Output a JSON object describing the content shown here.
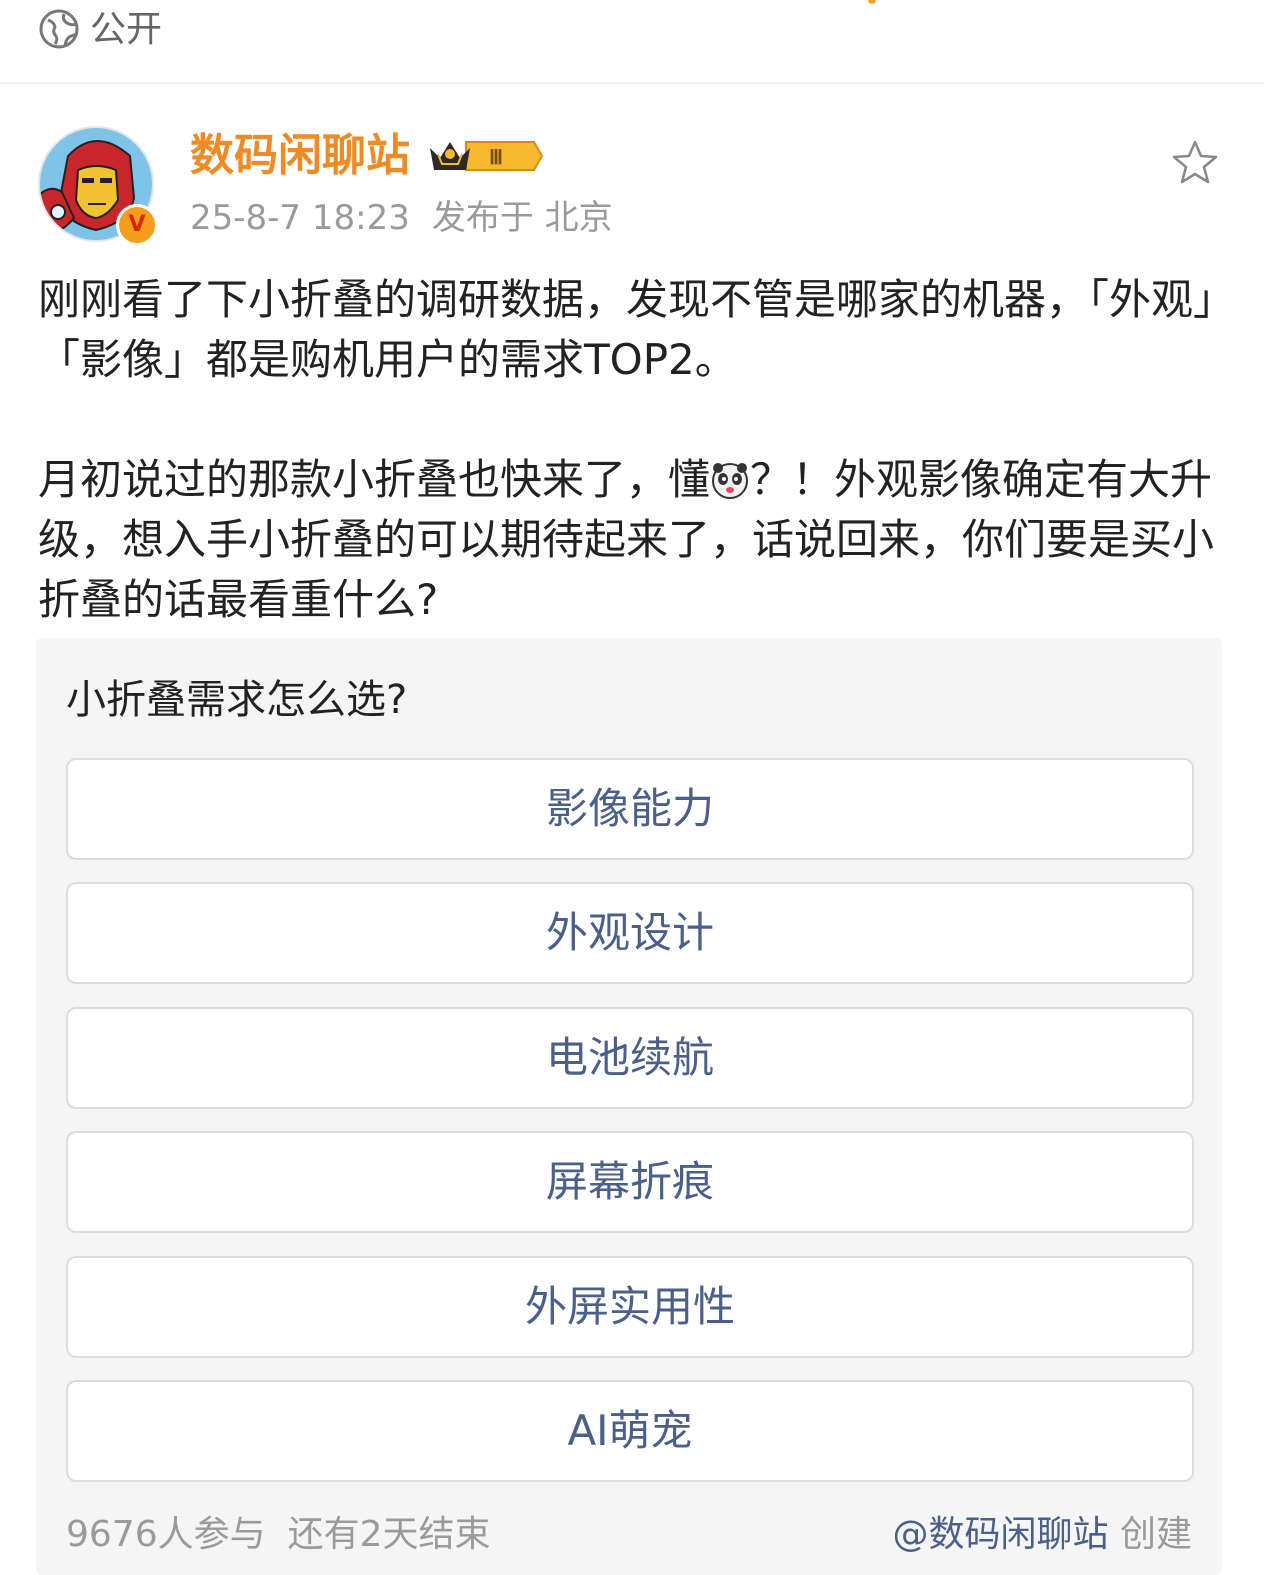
{
  "header": {
    "visibility_icon": "globe-icon",
    "visibility_label": "公开"
  },
  "post": {
    "author": {
      "name": "数码闲聊站",
      "avatar_icon": "iron-man-avatar",
      "verified_badge": "V",
      "level_badge": "Ⅲ"
    },
    "timestamp": "25-8-7 18:23",
    "location": "发布于 北京",
    "favorite_icon": "star-outline-icon",
    "paragraphs": {
      "p1": "刚刚看了下小折叠的调研数据，发现不管是哪家的机器，「外观」「影像」都是购机用户的需求TOP2。",
      "p2_before_emoji": "月初说过的那款小折叠也快来了，懂",
      "p2_emoji": "panda-emoji",
      "p2_after_emoji": "？！外观影像确定有大升级，想入手小折叠的可以期待起来了，话说回来，你们要是买小折叠的话最看重什么?"
    }
  },
  "poll": {
    "title": "小折叠需求怎么选?",
    "options": [
      "影像能力",
      "外观设计",
      "电池续航",
      "屏幕折痕",
      "外屏实用性",
      "AI萌宠"
    ],
    "participants": "9676人参与",
    "remaining": "还有2天结束",
    "creator": "@数码闲聊站",
    "creator_suffix": "创建"
  },
  "colors": {
    "username": "#f08a24",
    "option_text": "#4a5f8a",
    "meta_text": "#9a9a9a",
    "poll_bg": "#f5f5f5"
  }
}
